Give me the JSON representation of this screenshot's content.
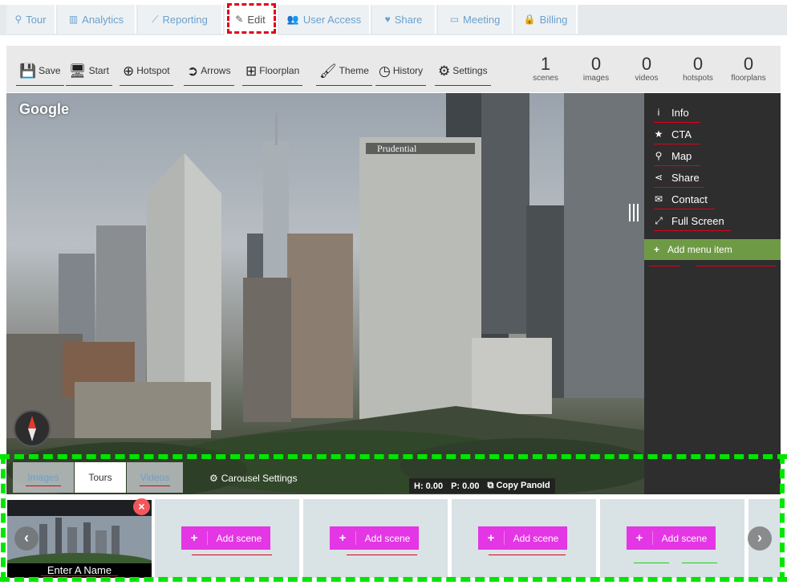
{
  "nav": {
    "tabs": [
      {
        "label": "Tour",
        "icon": "map-marker-icon"
      },
      {
        "label": "Analytics",
        "icon": "bar-chart-icon"
      },
      {
        "label": "Reporting",
        "icon": "line-chart-icon"
      },
      {
        "label": "Edit",
        "icon": "pencil-icon",
        "active": true
      },
      {
        "label": "User Access",
        "icon": "users-icon"
      },
      {
        "label": "Share",
        "icon": "heart-icon"
      },
      {
        "label": "Meeting",
        "icon": "monitor-icon"
      },
      {
        "label": "Billing",
        "icon": "lock-icon"
      }
    ]
  },
  "toolbar": {
    "items": [
      {
        "label": "Save",
        "icon": "floppy-disk-icon"
      },
      {
        "label": "Start",
        "icon": "monitor-icon"
      },
      {
        "label": "Hotspot",
        "icon": "plus-circle-icon"
      },
      {
        "label": "Arrows",
        "icon": "chevron-circle-right-icon"
      },
      {
        "label": "Floorplan",
        "icon": "floorplan-icon"
      },
      {
        "label": "Theme",
        "icon": "paintbrush-icon"
      },
      {
        "label": "History",
        "icon": "clock-icon"
      },
      {
        "label": "Settings",
        "icon": "gear-icon"
      }
    ],
    "stats": [
      {
        "value": "1",
        "label": "scenes"
      },
      {
        "value": "0",
        "label": "images"
      },
      {
        "value": "0",
        "label": "videos"
      },
      {
        "value": "0",
        "label": "hotspots"
      },
      {
        "value": "0",
        "label": "floorplans"
      }
    ]
  },
  "viewer": {
    "logo": "Google",
    "building_sign": "Prudential",
    "tabs": [
      {
        "label": "Images"
      },
      {
        "label": "Tours",
        "active": true
      },
      {
        "label": "Videos"
      }
    ],
    "carousel_settings": "Carousel Settings",
    "heading": "H: 0.00",
    "pitch": "P: 0.00",
    "copy_label": "Copy PanoId"
  },
  "menu": {
    "items": [
      {
        "label": "Info",
        "icon": "info-icon"
      },
      {
        "label": "CTA",
        "icon": "star-icon"
      },
      {
        "label": "Map",
        "icon": "map-marker-icon"
      },
      {
        "label": "Share",
        "icon": "share-icon"
      },
      {
        "label": "Contact",
        "icon": "envelope-icon"
      },
      {
        "label": "Full Screen",
        "icon": "expand-icon"
      }
    ],
    "add_label": "Add menu item"
  },
  "scenes": {
    "thumb_name": "Enter A Name",
    "add_label": "Add scene",
    "prev_glyph": "‹",
    "next_glyph": "›",
    "close_glyph": "×"
  },
  "colors": {
    "accent_link": "#6aa1cf",
    "red_underline": "#e0001b",
    "magenta_button": "#e436e4",
    "green_menu": "#6f9a45",
    "highlight_green": "#00e600"
  }
}
